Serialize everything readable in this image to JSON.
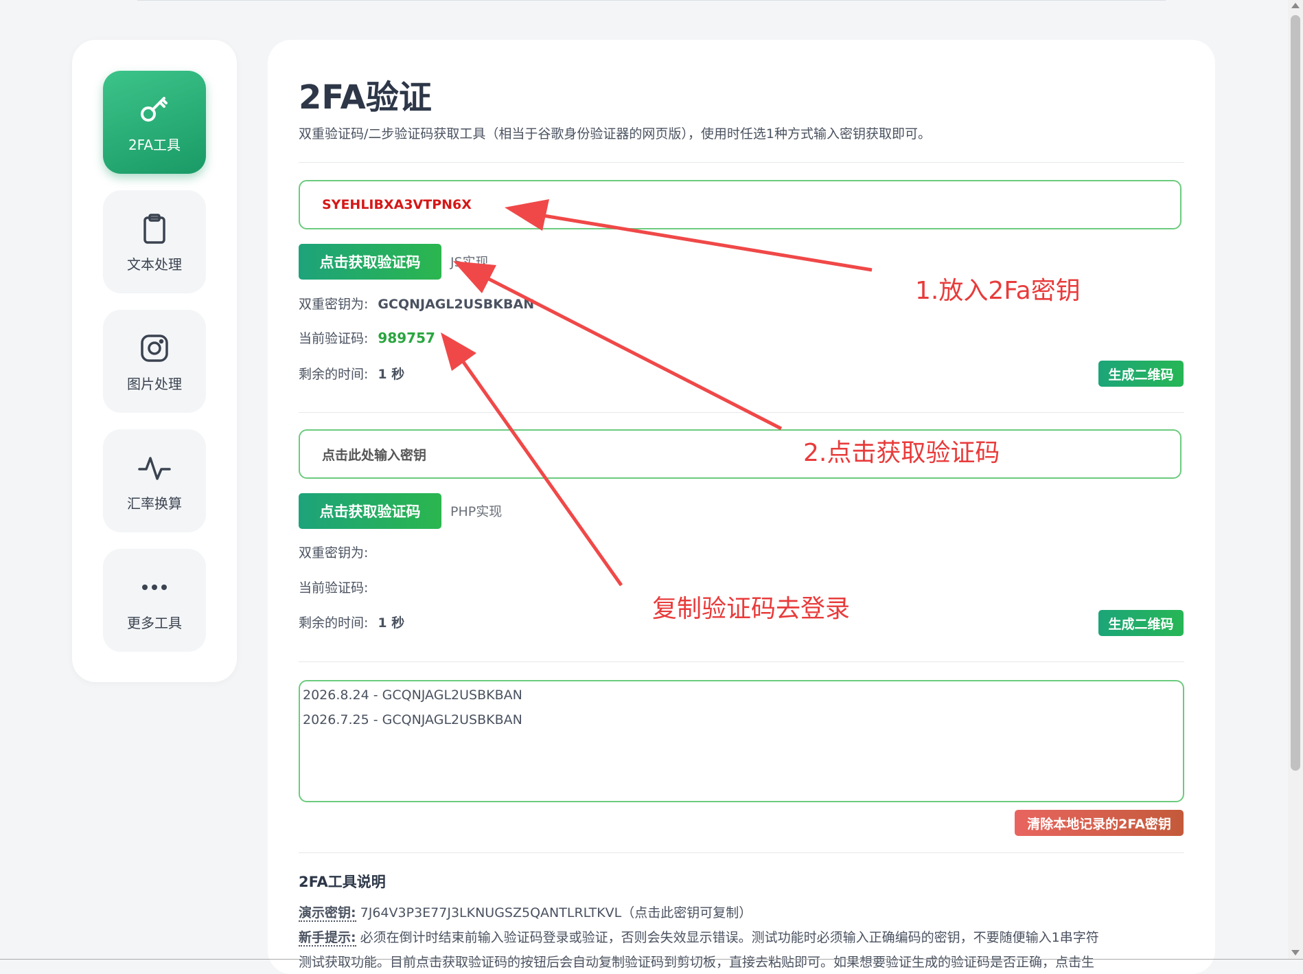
{
  "sidebar": {
    "items": [
      {
        "label": "2FA工具",
        "icon": "key-icon",
        "active": true
      },
      {
        "label": "文本处理",
        "icon": "clipboard-icon"
      },
      {
        "label": "图片处理",
        "icon": "instagram-icon"
      },
      {
        "label": "汇率换算",
        "icon": "activity-icon"
      },
      {
        "label": "更多工具",
        "icon": "more-icon"
      }
    ]
  },
  "main": {
    "title": "2FA验证",
    "description": "双重验证码/二步验证码获取工具（相当于谷歌身份验证器的网页版），使用时任选1种方式输入密钥获取即可。",
    "js_section": {
      "key_value": "SYEHLIBXA3VTPN6X",
      "get_code_label": "点击获取验证码",
      "impl_label": "JS实现",
      "secret_label": "双重密钥为:",
      "secret_value": "GCQNJAGL2USBKBAN",
      "code_label": "当前验证码:",
      "code_value": "989757",
      "remaining_label": "剩余的时间:",
      "remaining_value": "1 秒",
      "qr_label": "生成二维码"
    },
    "php_section": {
      "key_placeholder": "点击此处输入密钥",
      "get_code_label": "点击获取验证码",
      "impl_label": "PHP实现",
      "secret_label": "双重密钥为:",
      "code_label": "当前验证码:",
      "remaining_label": "剩余的时间:",
      "remaining_value": "1 秒",
      "qr_label": "生成二维码"
    },
    "history": [
      "2026.8.24 - GCQNJAGL2USBKBAN",
      "2026.7.25 - GCQNJAGL2USBKBAN"
    ],
    "clear_label": "清除本地记录的2FA密钥",
    "help": {
      "title": "2FA工具说明",
      "demo_key_label": "演示密钥:",
      "demo_key_text": "7J64V3P3E77J3LKNUGSZ5QANTLRLTKVL（点击此密钥可复制）",
      "tip_label": "新手提示:",
      "tip_text": "必须在倒计时结束前输入验证码登录或验证，否则会失效显示错误。测试功能时必须输入正确编码的密钥，不要随便输入1串字符",
      "tip_text_2": "测试获取功能。目前点击获取验证码的按钮后会自动复制验证码到剪切板，直接去粘贴即可。如果想要验证生成的验证码是否正确，点击生"
    }
  },
  "annotations": {
    "step1": "1.放入2Fa密钥",
    "step2": "2.点击获取验证码",
    "step3": "复制验证码去登录"
  },
  "colors": {
    "accent_green": "#1da37a",
    "annotation_red": "#e83b3b",
    "key_red": "#d51717",
    "code_green": "#2aa53f"
  }
}
